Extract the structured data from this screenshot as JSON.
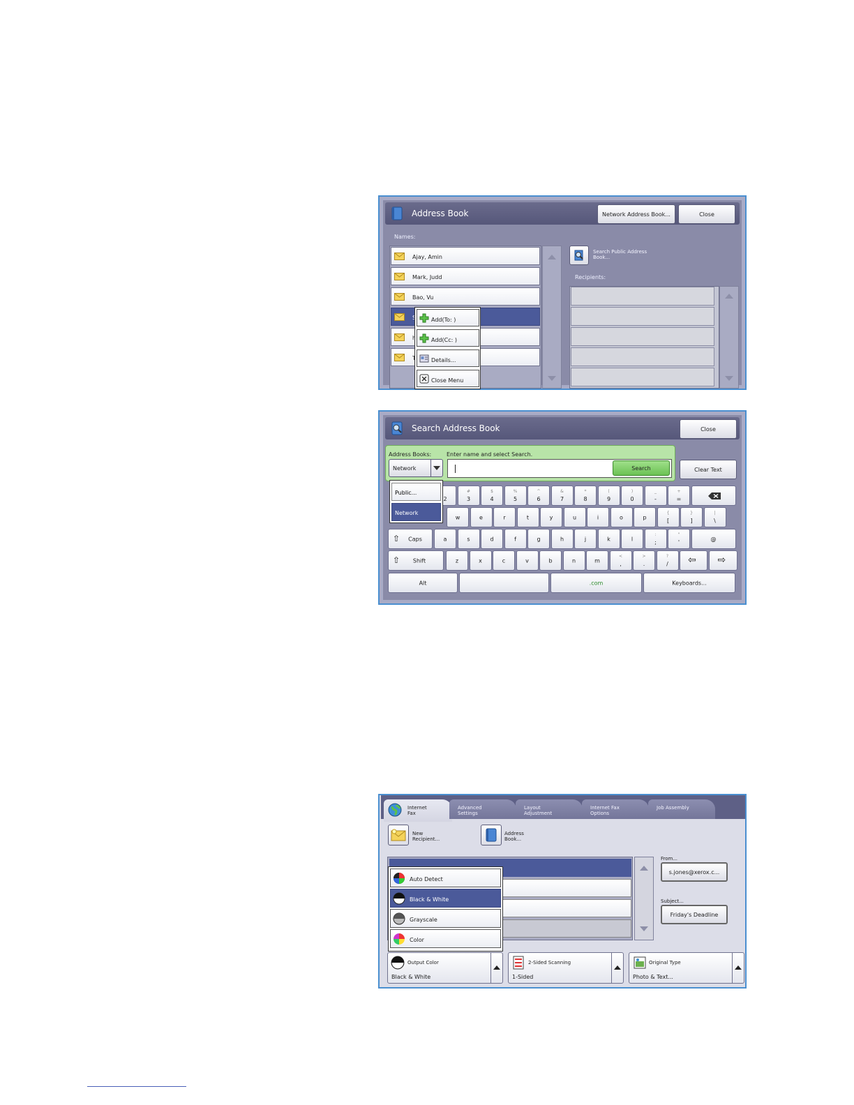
{
  "address_book": {
    "title": "Address Book",
    "network_button": "Network Address Book...",
    "close_button": "Close",
    "names_label": "Names:",
    "names": [
      "Ajay, Amin",
      "Mark, Judd",
      "Bao, Vu",
      "S",
      "h",
      "T"
    ],
    "context_menu": [
      "Add(To: )",
      "Add(Cc: )",
      "Details...",
      "Close Menu"
    ],
    "search_public": "Search Public Address Book...",
    "recipients_label": "Recipients:"
  },
  "search_book": {
    "title": "Search Address Book",
    "close_button": "Close",
    "address_books_label": "Address Books:",
    "selected_book": "Network",
    "instruction": "Enter name and select Search.",
    "search_button": "Search",
    "clear_button": "Clear Text",
    "dropdown": [
      "Public...",
      "Network"
    ],
    "keyboard": {
      "row1": [
        [
          "",
          "2"
        ],
        [
          "#",
          "3"
        ],
        [
          "$",
          "4"
        ],
        [
          "%",
          "5"
        ],
        [
          "^",
          "6"
        ],
        [
          "&",
          "7"
        ],
        [
          "*",
          "8"
        ],
        [
          "(",
          "9"
        ],
        [
          ")",
          "0"
        ],
        [
          "_",
          "-"
        ],
        [
          "+",
          "="
        ]
      ],
      "row2": [
        "w",
        "e",
        "r",
        "t",
        "y",
        "u",
        "i",
        "o",
        "p",
        [
          "{",
          "["
        ],
        [
          "}",
          "]"
        ],
        [
          "|",
          "\\"
        ]
      ],
      "row3": [
        "a",
        "s",
        "d",
        "f",
        "g",
        "h",
        "j",
        "k",
        "l",
        [
          ":",
          ";"
        ],
        [
          "\"",
          "'"
        ],
        "@"
      ],
      "row4": [
        "z",
        "x",
        "c",
        "v",
        "b",
        "n",
        "m",
        [
          "<",
          ","
        ],
        [
          ">",
          "."
        ],
        [
          "?",
          "/"
        ]
      ],
      "caps": "Caps",
      "shift": "Shift",
      "alt": "Alt",
      "com": ".com",
      "keyboards": "Keyboards..."
    }
  },
  "fax": {
    "tabs": [
      "Internet Fax",
      "Advanced Settings",
      "Layout Adjustment",
      "Internet Fax Options",
      "Job Assembly"
    ],
    "new_recipient": "New Recipient...",
    "address_book": "Address Book...",
    "color_menu": [
      "Auto Detect",
      "Black & White",
      "Grayscale",
      "Color"
    ],
    "from_label": "From...",
    "from_value": "s.jones@xerox.c...",
    "subject_label": "Subject...",
    "subject_value": "Friday's Deadline",
    "output_color_label": "Output Color",
    "output_color_value": "Black & White",
    "sided_label": "2-Sided Scanning",
    "sided_value": "1-Sided",
    "original_label": "Original Type",
    "original_value": "Photo & Text..."
  }
}
